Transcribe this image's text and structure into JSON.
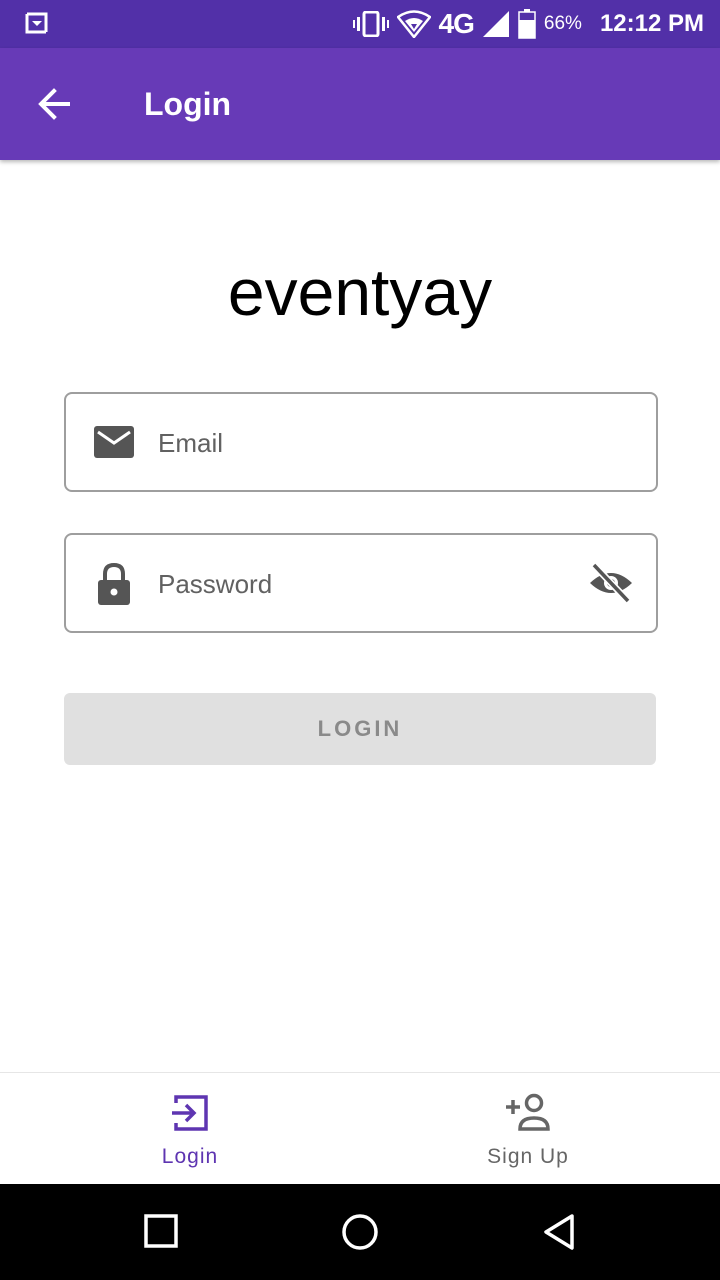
{
  "status_bar": {
    "network": "4G",
    "battery": "66%",
    "time": "12:12 PM"
  },
  "app_bar": {
    "title": "Login"
  },
  "brand": "eventyay",
  "form": {
    "email_placeholder": "Email",
    "password_placeholder": "Password",
    "login_label": "LOGIN"
  },
  "bottom_nav": {
    "items": [
      {
        "label": "Login",
        "icon": "login-icon",
        "active": true
      },
      {
        "label": "Sign Up",
        "icon": "person-add-icon",
        "active": false
      }
    ]
  },
  "colors": {
    "primary": "#673ab7",
    "primary_dark": "#5230a8",
    "accent_active": "#5e35b1",
    "disabled_button": "#e0e0e0"
  }
}
